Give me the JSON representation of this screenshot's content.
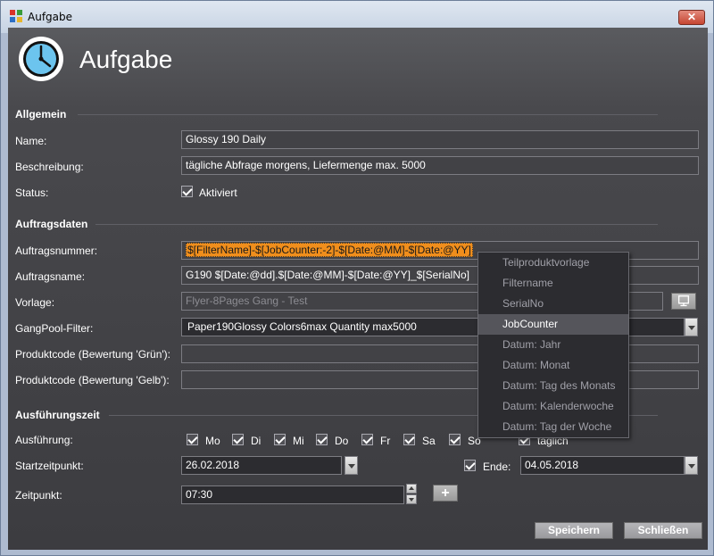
{
  "window": {
    "title": "Aufgabe",
    "close_label": "✕"
  },
  "header": {
    "heading": "Aufgabe",
    "icon": "clock-icon"
  },
  "general": {
    "section_title": "Allgemein",
    "name_label": "Name:",
    "name_value": "Glossy 190 Daily",
    "description_label": "Beschreibung:",
    "description_value": "tägliche Abfrage morgens, Liefermenge max. 5000",
    "status_label": "Status:",
    "status_checkbox_label": "Aktiviert",
    "status_checked": true
  },
  "job": {
    "section_title": "Auftragsdaten",
    "number_label": "Auftragsnummer:",
    "number_value": "$[FilterName]-$[JobCounter:-2]-$[Date:@MM]-$[Date:@YY]",
    "name_label": "Auftragsname:",
    "name_value": "G190 $[Date:@dd].$[Date:@MM]-$[Date:@YY]_$[SerialNo]",
    "template_label": "Vorlage:",
    "template_value": "Flyer-8Pages Gang - Test",
    "gangpool_label": "GangPool-Filter:",
    "gangpool_value": "Paper190Glossy Colors6max Quantity max5000",
    "product_green_label": "Produktcode (Bewertung 'Grün'):",
    "product_green_value": "",
    "product_yellow_label": "Produktcode (Bewertung 'Gelb'):",
    "product_yellow_value": ""
  },
  "placeholder_menu": {
    "items": [
      "Teilproduktvorlage",
      "Filtername",
      "SerialNo",
      "JobCounter",
      "Datum: Jahr",
      "Datum: Monat",
      "Datum: Tag des Monats",
      "Datum: Kalenderwoche",
      "Datum: Tag der Woche"
    ],
    "selected": "JobCounter"
  },
  "schedule": {
    "section_title": "Ausführungszeit",
    "execution_label": "Ausführung:",
    "days": [
      "Mo",
      "Di",
      "Mi",
      "Do",
      "Fr",
      "Sa",
      "So"
    ],
    "daily_label": "täglich",
    "start_label": "Startzeitpunkt:",
    "start_value": "26.02.2018",
    "end_label": "Ende:",
    "end_value": "04.05.2018",
    "time_label": "Zeitpunkt:",
    "time_value": "07:30",
    "add_label": "+"
  },
  "footer": {
    "save_label": "Speichern",
    "close_label": "Schließen"
  },
  "colors": {
    "highlight": "#f08e1c",
    "panel": "#3c3c40",
    "accent_blue": "#6cc4ee"
  }
}
